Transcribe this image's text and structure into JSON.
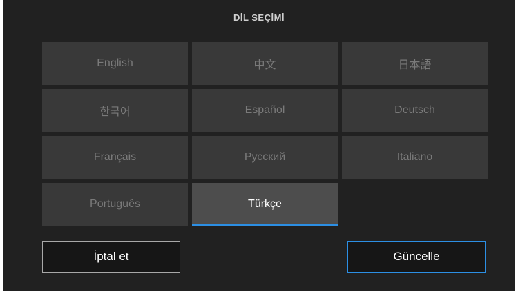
{
  "dialog": {
    "title": "DİL SEÇİMİ",
    "accent_color": "#2c8fe4",
    "selected_language": "Türkçe",
    "languages": [
      {
        "label": "English"
      },
      {
        "label": "中文"
      },
      {
        "label": "日本語"
      },
      {
        "label": "한국어"
      },
      {
        "label": "Español"
      },
      {
        "label": "Deutsch"
      },
      {
        "label": "Français"
      },
      {
        "label": "Русский"
      },
      {
        "label": "Italiano"
      },
      {
        "label": "Português"
      },
      {
        "label": "Türkçe"
      }
    ],
    "cancel_label": "İptal et",
    "update_label": "Güncelle"
  }
}
